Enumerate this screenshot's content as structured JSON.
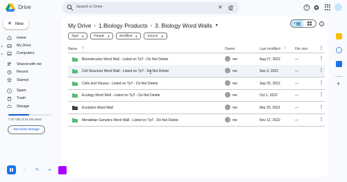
{
  "app": {
    "name": "Drive"
  },
  "search": {
    "placeholder": "Search in Drive"
  },
  "new_button": {
    "label": "New"
  },
  "sidebar": {
    "items": [
      {
        "label": "Home",
        "icon": "home-icon"
      },
      {
        "label": "My Drive",
        "icon": "my-drive-icon",
        "expandable": true
      },
      {
        "label": "Computers",
        "icon": "computer-icon",
        "expandable": true
      },
      {
        "label": "Shared with me",
        "icon": "shared-icon"
      },
      {
        "label": "Recent",
        "icon": "clock-icon"
      },
      {
        "label": "Starred",
        "icon": "star-icon"
      },
      {
        "label": "Spam",
        "icon": "spam-icon"
      },
      {
        "label": "Trash",
        "icon": "trash-icon"
      },
      {
        "label": "Storage",
        "icon": "cloud-icon"
      }
    ],
    "storage_text": "7.37 GB of 15 GB used",
    "storage_fraction": 0.49,
    "get_more_label": "Get more storage"
  },
  "breadcrumb": {
    "root": "My Drive",
    "level1": "1.Biology Products",
    "current": "3. Biology Word Walls"
  },
  "filters": [
    "Type",
    "People",
    "Modified",
    "Source"
  ],
  "table": {
    "headers": {
      "name": "Name",
      "owner": "Owner",
      "modified": "Last modified",
      "size": "File size"
    },
    "rows": [
      {
        "name": "Biomolecules Word Wall - Listed on TpT - Do Not Delete",
        "owner": "me",
        "modified": "Aug 27, 2022",
        "size": "—",
        "folder_color": "#5bb974"
      },
      {
        "name": "Cell Structure Word Wall - Listed on TpT - Do Not Delete",
        "owner": "me",
        "modified": "Sep 3, 2022",
        "size": "—",
        "folder_color": "#5bb974"
      },
      {
        "name": "Cells and Viruses - Listed on TpT - Do Not Delete",
        "owner": "me",
        "modified": "Sep 25, 2022",
        "size": "—",
        "folder_color": "#5bb974"
      },
      {
        "name": "Ecology Word Wall - Listed on TpT - Do Not Delete",
        "owner": "me",
        "modified": "Oct 1, 2022",
        "size": "—",
        "folder_color": "#5bb974"
      },
      {
        "name": "Evolution Word Wall",
        "owner": "me",
        "modified": "Mar 25, 2023",
        "size": "—",
        "folder_color": "#3c4043"
      },
      {
        "name": "Mendelian Genetics Word Wall - Listed on TpT - Do Not Delete",
        "owner": "me",
        "modified": "Nov 12, 2022",
        "size": "—",
        "folder_color": "#5bb974"
      }
    ]
  },
  "colors": {
    "accent": "#0b57d0",
    "selected_view": "#c2e7ff",
    "dock_purple": "#aa00ff"
  }
}
